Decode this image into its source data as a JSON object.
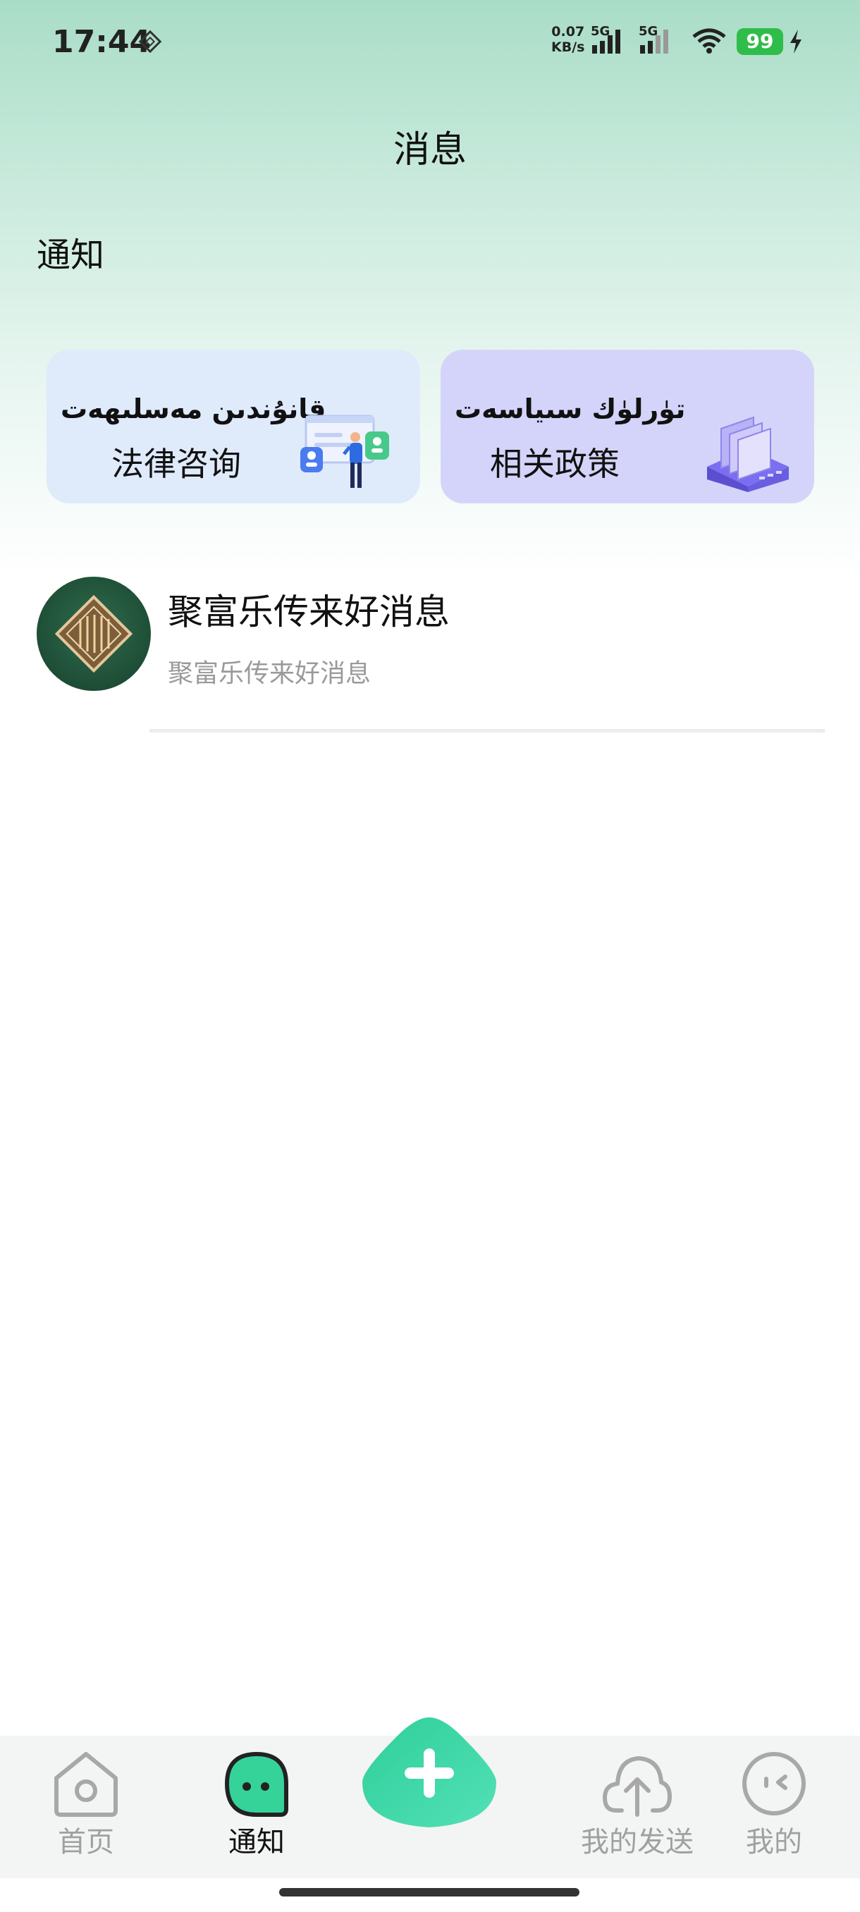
{
  "status_bar": {
    "time": "17:44",
    "net_speed_value": "0.07",
    "net_speed_unit": "KB/s",
    "sim1_label": "5G",
    "sim2_label": "5G",
    "battery": "99"
  },
  "header": {
    "title": "消息"
  },
  "section": {
    "label": "通知"
  },
  "cards": [
    {
      "uyghur": "قانۇندىن مەسلىھەت",
      "chinese": "法律咨询",
      "icon": "legal-consult-illustration"
    },
    {
      "uyghur": "تۈرلۈك سىياسەت",
      "chinese": "相关政策",
      "icon": "policy-server-illustration"
    }
  ],
  "messages": [
    {
      "title": "聚富乐传来好消息",
      "preview": "聚富乐传来好消息",
      "avatar": "brand-logo-avatar"
    }
  ],
  "tabbar": {
    "tabs": [
      {
        "label": "首页",
        "icon": "home-icon",
        "active": false
      },
      {
        "label": "通知",
        "icon": "chat-bubble-icon",
        "active": true
      },
      {
        "label": "",
        "icon": "plus-icon",
        "active": false
      },
      {
        "label": "我的发送",
        "icon": "cloud-upload-icon",
        "active": false
      },
      {
        "label": "我的",
        "icon": "face-icon",
        "active": false
      }
    ]
  },
  "colors": {
    "accent": "#2fcf9a",
    "battery": "#2ebd4a",
    "card_legal": "#dfeafb",
    "card_policy": "#d4d4fb"
  }
}
